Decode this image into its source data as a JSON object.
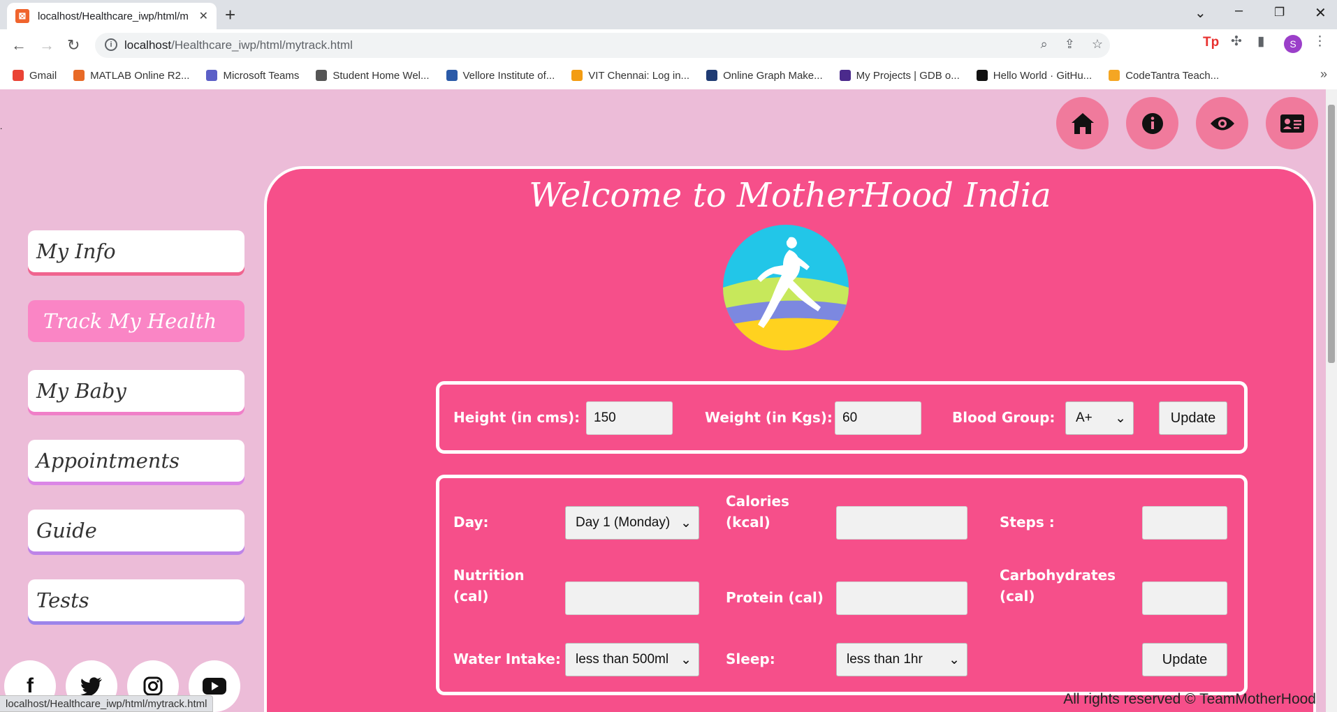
{
  "browser": {
    "tab_title": "localhost/Healthcare_iwp/html/m",
    "url_host": "localhost",
    "url_path": "/Healthcare_iwp/html/mytrack.html",
    "avatar_letter": "S",
    "status_url": "localhost/Healthcare_iwp/html/mytrack.html",
    "bookmarks": [
      {
        "label": "Gmail",
        "color": "#ea4335"
      },
      {
        "label": "MATLAB Online R2...",
        "color": "#e86a27"
      },
      {
        "label": "Microsoft Teams",
        "color": "#5b5fc7"
      },
      {
        "label": "Student Home Wel...",
        "color": "#555555"
      },
      {
        "label": "Vellore Institute of...",
        "color": "#2b5aa8"
      },
      {
        "label": "VIT Chennai: Log in...",
        "color": "#f39c12"
      },
      {
        "label": "Online Graph Make...",
        "color": "#1f3b73"
      },
      {
        "label": "My Projects | GDB o...",
        "color": "#4b2a8c"
      },
      {
        "label": "Hello World · GitHu...",
        "color": "#111111"
      },
      {
        "label": "CodeTantra Teach...",
        "color": "#f5a623"
      }
    ]
  },
  "sidebar": {
    "items": [
      {
        "label": "My Info"
      },
      {
        "label": "Track My Health"
      },
      {
        "label": "My Baby"
      },
      {
        "label": "Appointments"
      },
      {
        "label": "Guide"
      },
      {
        "label": "Tests"
      }
    ]
  },
  "main": {
    "title": "Welcome to MotherHood India",
    "body_panel": {
      "height_label": "Height (in cms):",
      "height_value": "150",
      "weight_label": "Weight (in Kgs):",
      "weight_value": "60",
      "blood_label": "Blood Group:",
      "blood_value": "A+",
      "update_label": "Update"
    },
    "daily_panel": {
      "day_label": "Day:",
      "day_value": "Day 1 (Monday)",
      "calories_label": "Calories (kcal)",
      "steps_label": "Steps :",
      "nutrition_label": "Nutrition (cal)",
      "protein_label": "Protein (cal)",
      "carbs_label": "Carbohydrates (cal)",
      "water_label": "Water Intake:",
      "water_value": "less than 500ml",
      "sleep_label": "Sleep:",
      "sleep_value": "less than 1hr",
      "update_label": "Update"
    }
  },
  "footer": {
    "text": "All rights reserved © TeamMotherHood"
  },
  "colors": {
    "accent": "#f64f8a",
    "page_bg": "#ecbcd8",
    "active_nav": "#fa85c5"
  }
}
